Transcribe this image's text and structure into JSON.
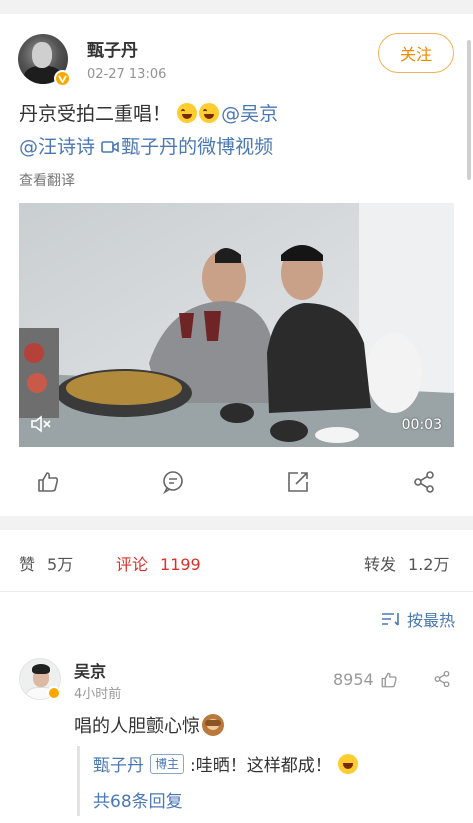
{
  "post": {
    "author": "甄子丹",
    "time": "02-27 13:06",
    "follow_label": "关注",
    "text_main": "丹京受拍二重唱！",
    "mention_1": "@吴京",
    "mention_2": "@汪诗诗",
    "video_link_text": "甄子丹的微博视频",
    "translate_label": "查看翻译"
  },
  "video": {
    "duration": "00:03"
  },
  "actions": {
    "icons": [
      "like-icon",
      "comment-icon",
      "repost-icon",
      "share-icon"
    ]
  },
  "stats": {
    "likes_label": "赞",
    "likes_value": "5万",
    "comments_label": "评论",
    "comments_value": "1199",
    "reposts_label": "转发",
    "reposts_value": "1.2万"
  },
  "sort": {
    "label": "按最热"
  },
  "comment": {
    "author": "吴京",
    "time": "4小时前",
    "likes": "8954",
    "text": "唱的人胆颤心惊",
    "reply": {
      "author": "甄子丹",
      "tag": "博主",
      "text": ":哇晒！这样都成！",
      "more": "共68条回复"
    }
  },
  "colors": {
    "link": "#4a78b4",
    "follow": "#f08a00",
    "active_tab": "#d9302a",
    "badge": "#f7a900"
  }
}
